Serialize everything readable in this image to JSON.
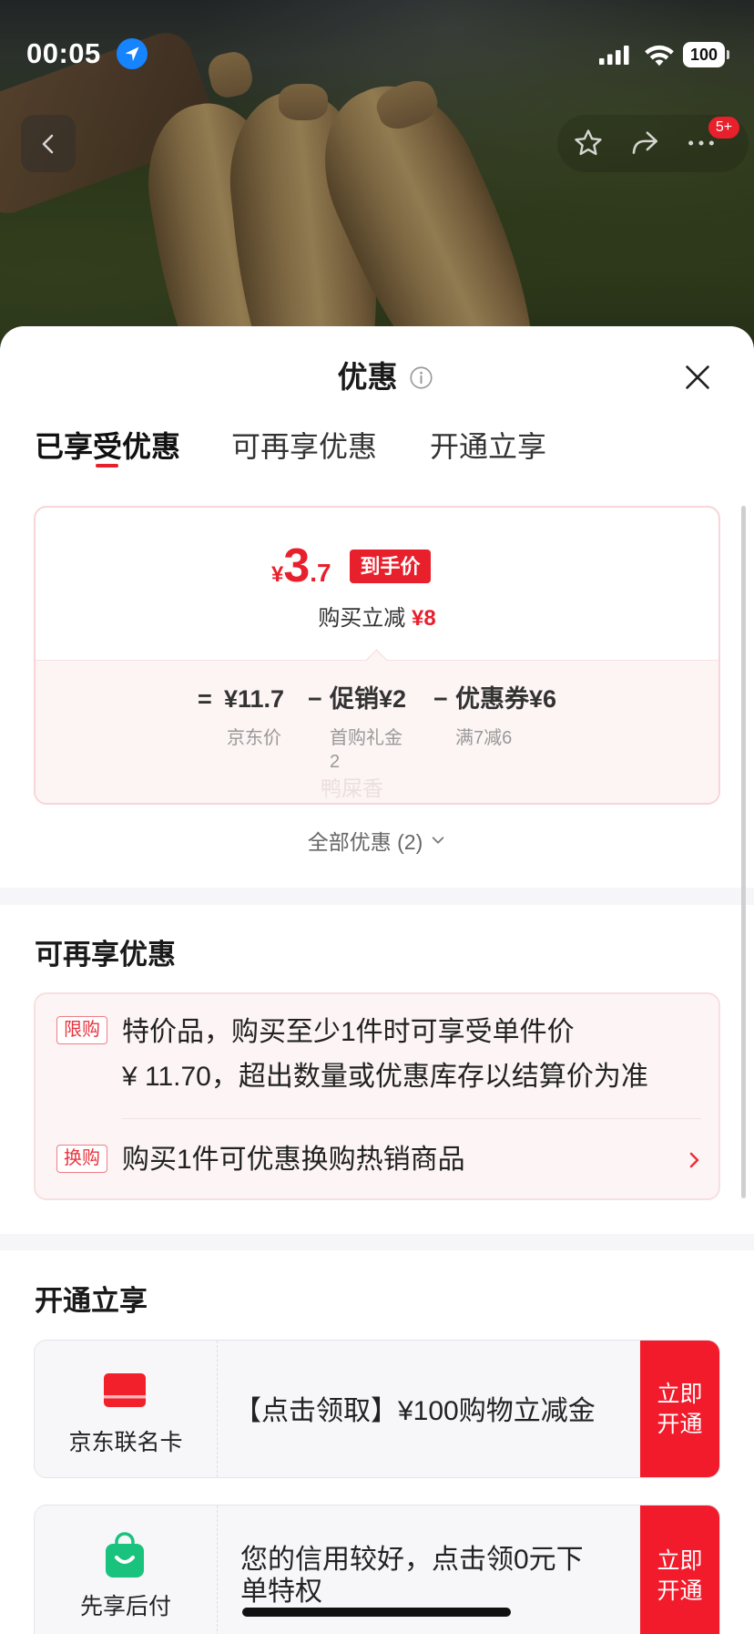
{
  "status_bar": {
    "time": "00:05",
    "battery": "100"
  },
  "nav": {
    "cart_badge": "5+"
  },
  "sheet": {
    "title": "优惠",
    "tabs": [
      {
        "label": "已享受优惠",
        "active": true
      },
      {
        "label": "可再享优惠",
        "active": false
      },
      {
        "label": "开通立享",
        "active": false
      }
    ],
    "price_card": {
      "final_price": {
        "currency": "¥",
        "integer": "3",
        "decimal": ".7"
      },
      "final_badge": "到手价",
      "instant_reduce_label": "购买立减",
      "instant_reduce_value": "¥8",
      "breakdown": {
        "equals": "=",
        "jd_price": {
          "value": "¥11.7",
          "label": "京东价"
        },
        "minus_1": "−",
        "promotion": {
          "value": "促销¥2",
          "label": "首购礼金2"
        },
        "minus_2": "−",
        "coupon": {
          "value": "优惠券¥6",
          "label": "满7减6"
        }
      },
      "watermark": "鸭屎香"
    },
    "all_offers": "全部优惠 (2)",
    "more_offers": {
      "heading": "可再享优惠",
      "items": [
        {
          "tag": "限购",
          "lines": [
            "特价品，购买至少1件时可享受单件价",
            "¥ 11.70，超出数量或优惠库存以结算价为准"
          ]
        },
        {
          "tag": "换购",
          "text": "购买1件可优惠换购热销商品"
        }
      ]
    },
    "activate": {
      "heading": "开通立享",
      "items": [
        {
          "icon": "credit-card-icon",
          "name": "京东联名卡",
          "text": "【点击领取】¥100购物立减金",
          "button": "立即开通"
        },
        {
          "icon": "shopping-bag-icon",
          "name": "先享后付",
          "text": "您的信用较好，点击领0元下单特权",
          "button": "立即开通"
        }
      ]
    }
  },
  "colors": {
    "accent_red": "#e8202c",
    "button_red": "#f21b2b",
    "pay_later_green": "#19c37d",
    "location_blue": "#1683ff"
  }
}
